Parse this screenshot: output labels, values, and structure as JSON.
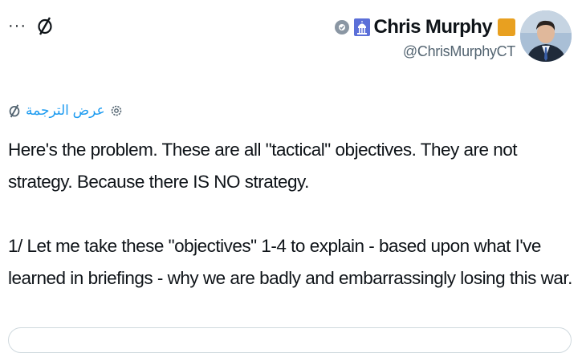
{
  "header": {
    "more_label": "···",
    "more_icon": "more-dots-icon",
    "grok_icon": "grok-slash-icon"
  },
  "author": {
    "name": "Chris Murphy",
    "handle": "@ChrisMurphyCT",
    "badges": [
      "gear-affiliation-icon",
      "capitol-dome-icon",
      "verified-gold-badge"
    ],
    "badge_gold": "#e8a020",
    "avatar": "avatar-photo"
  },
  "translate": {
    "label": "عرض الترجمة",
    "link_color": "#1d9bf0"
  },
  "tweet": {
    "paragraph_1": "Here's the problem. These are all \"tactical\" objectives. They are not strategy. Because there IS NO strategy.",
    "paragraph_2": "1/ Let me take these \"objectives\" 1-4 to explain - based upon what I've learned in briefings - why we are badly and embarrassingly losing this war."
  }
}
